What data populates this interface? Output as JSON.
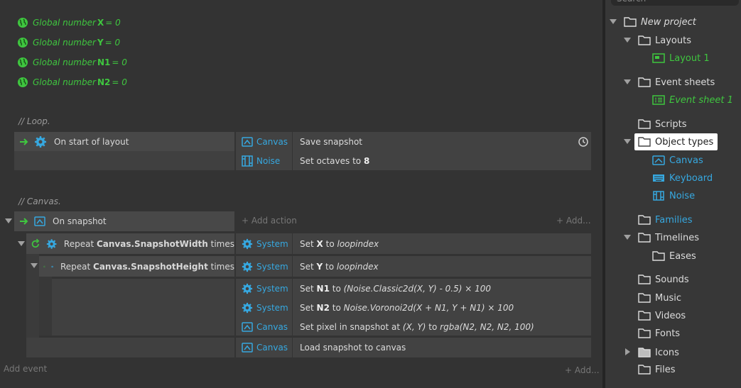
{
  "globals": [
    {
      "prefix": "Global number",
      "name": "X",
      "value": "= 0"
    },
    {
      "prefix": "Global number",
      "name": "Y",
      "value": "= 0"
    },
    {
      "prefix": "Global number",
      "name": "N1",
      "value": "= 0"
    },
    {
      "prefix": "Global number",
      "name": "N2",
      "value": "= 0"
    }
  ],
  "comments": [
    "//  Loop.",
    "//  Canvas."
  ],
  "loop_event": {
    "condition": "On start of layout",
    "actions": [
      {
        "object": "Canvas",
        "text": "Save snapshot"
      },
      {
        "object": "Noise",
        "pre": "Set octaves to ",
        "bold": "8"
      }
    ]
  },
  "canvas_event": {
    "condition": "On snapshot",
    "add_action": "+ Add action",
    "add": "+ Add...",
    "repeat1": {
      "pre": "Repeat ",
      "bold": "Canvas.SnapshotWidth",
      "post": " times"
    },
    "repeat2": {
      "pre": "Repeat ",
      "bold": "Canvas.SnapshotHeight",
      "post": " times"
    },
    "act_x": {
      "object": "System",
      "pre": "Set ",
      "bold": "X",
      "mid": " to ",
      "ital": "loopindex"
    },
    "act_y": {
      "object": "System",
      "pre": "Set ",
      "bold": "Y",
      "mid": " to ",
      "ital": "loopindex"
    },
    "act_n1": {
      "object": "System",
      "pre": "Set ",
      "bold": "N1",
      "mid": " to ",
      "ital": "(Noise.Classic2d(X, Y) - 0.5) × 100"
    },
    "act_n2": {
      "object": "System",
      "pre": "Set ",
      "bold": "N2",
      "mid": " to ",
      "ital": "Noise.Voronoi2d(X + N1, Y + N1) × 100"
    },
    "act_px": {
      "object": "Canvas",
      "pre": "Set pixel in snapshot at ",
      "ital": "(X, Y)",
      "mid": " to ",
      "ital2": "rgba(N2, N2, N2, 100)"
    },
    "act_load": {
      "object": "Canvas",
      "text": "Load snapshot to canvas"
    }
  },
  "footer": {
    "add_event": "Add event",
    "add": "+ Add..."
  },
  "project": {
    "search_placeholder": "Search",
    "root": "New project",
    "layouts": "Layouts",
    "layout1": "Layout 1",
    "event_sheets": "Event sheets",
    "event_sheet1": "Event sheet 1",
    "scripts": "Scripts",
    "object_types": "Object types",
    "obj_canvas": "Canvas",
    "obj_keyboard": "Keyboard",
    "obj_noise": "Noise",
    "families": "Families",
    "timelines": "Timelines",
    "eases": "Eases",
    "sounds": "Sounds",
    "music": "Music",
    "videos": "Videos",
    "fonts": "Fonts",
    "icons": "Icons",
    "files": "Files"
  },
  "colors": {
    "green": "#3fc63f",
    "blue": "#36a8e0",
    "panel": "#373737"
  }
}
